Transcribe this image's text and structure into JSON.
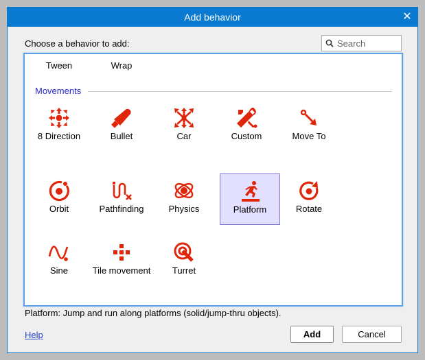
{
  "dialog": {
    "title": "Add behavior",
    "close_glyph": "✕"
  },
  "prompt": "Choose a behavior to add:",
  "search": {
    "placeholder": "Search",
    "value": ""
  },
  "top_items": [
    {
      "label": "Tween"
    },
    {
      "label": "Wrap"
    }
  ],
  "section": {
    "label": "Movements",
    "items": [
      {
        "label": "8 Direction",
        "icon": "eight-direction-icon"
      },
      {
        "label": "Bullet",
        "icon": "bullet-icon"
      },
      {
        "label": "Car",
        "icon": "car-icon"
      },
      {
        "label": "Custom",
        "icon": "custom-wrench-icon"
      },
      {
        "label": "Move To",
        "icon": "move-to-icon"
      },
      {
        "label": "Orbit",
        "icon": "orbit-icon"
      },
      {
        "label": "Pathfinding",
        "icon": "pathfinding-icon"
      },
      {
        "label": "Physics",
        "icon": "physics-icon"
      },
      {
        "label": "Platform",
        "icon": "platform-icon",
        "selected": true
      },
      {
        "label": "Rotate",
        "icon": "rotate-icon"
      },
      {
        "label": "Sine",
        "icon": "sine-icon"
      },
      {
        "label": "Tile movement",
        "icon": "tile-movement-icon"
      },
      {
        "label": "Turret",
        "icon": "turret-icon"
      }
    ]
  },
  "description": "Platform: Jump and run along platforms (solid/jump-thru objects).",
  "footer": {
    "help": "Help",
    "add": "Add",
    "cancel": "Cancel"
  },
  "colors": {
    "titlebar": "#0a7ad1",
    "icon": "#e0260a",
    "selection": "#e2dfff",
    "section": "#2a2acc"
  }
}
